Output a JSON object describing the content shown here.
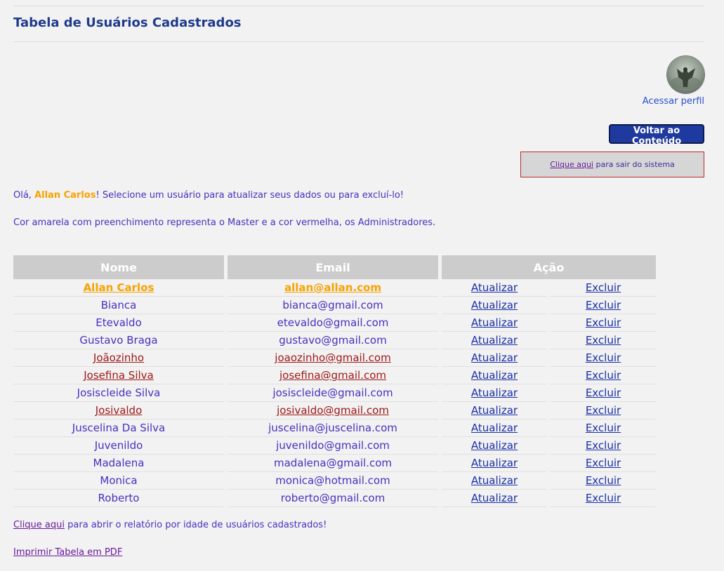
{
  "page": {
    "title": "Tabela de Usuários Cadastrados"
  },
  "profile": {
    "link_label": "Acessar perfil",
    "avatar_icon": "gargoyle-avatar-icon"
  },
  "actions": {
    "back_label": "Voltar ao Conteúdo",
    "logout_link": "Clique aqui",
    "logout_text": " para sair do sistema"
  },
  "greeting": {
    "prefix": "Olá, ",
    "name": "Allan Carlos",
    "suffix": "! Selecione um usuário para atualizar seus dados ou para excluí-lo!"
  },
  "legend_note": "Cor amarela com preenchimento representa o Master e a cor vermelha, os Administradores.",
  "colors": {
    "master": "#f7a200",
    "admin": "#a01818",
    "regular": "#4a2fc0",
    "header_bg": "#cccccc",
    "button_bg": "#1f3a9f"
  },
  "table": {
    "headers": [
      "Nome",
      "Email",
      "Ação"
    ],
    "update_label": "Atualizar",
    "delete_label": "Excluir",
    "rows": [
      {
        "name": "Allan Carlos",
        "email": "allan@allan.com",
        "role": "master"
      },
      {
        "name": "Bianca",
        "email": "bianca@gmail.com",
        "role": "regular"
      },
      {
        "name": "Etevaldo",
        "email": "etevaldo@gmail.com",
        "role": "regular"
      },
      {
        "name": "Gustavo Braga",
        "email": "gustavo@gmail.com",
        "role": "regular"
      },
      {
        "name": "Joãozinho",
        "email": "joaozinho@gmail.com",
        "role": "admin"
      },
      {
        "name": "Josefina Silva",
        "email": "josefina@gmail.com",
        "role": "admin"
      },
      {
        "name": "Josiscleide Silva",
        "email": "josiscleide@gmail.com",
        "role": "regular"
      },
      {
        "name": "Josivaldo",
        "email": "josivaldo@gmail.com",
        "role": "admin"
      },
      {
        "name": "Juscelina Da Silva",
        "email": "juscelina@juscelina.com",
        "role": "regular"
      },
      {
        "name": "Juvenildo",
        "email": "juvenildo@gmail.com",
        "role": "regular"
      },
      {
        "name": "Madalena",
        "email": "madalena@gmail.com",
        "role": "regular"
      },
      {
        "name": "Monica",
        "email": "monica@hotmail.com",
        "role": "regular"
      },
      {
        "name": "Roberto",
        "email": "roberto@gmail.com",
        "role": "regular"
      }
    ]
  },
  "footer": {
    "report_link": "Clique aqui",
    "report_text": " para abrir o relatório por idade de usuários cadastrados!",
    "pdf_link": "Imprimir Tabela em PDF"
  }
}
